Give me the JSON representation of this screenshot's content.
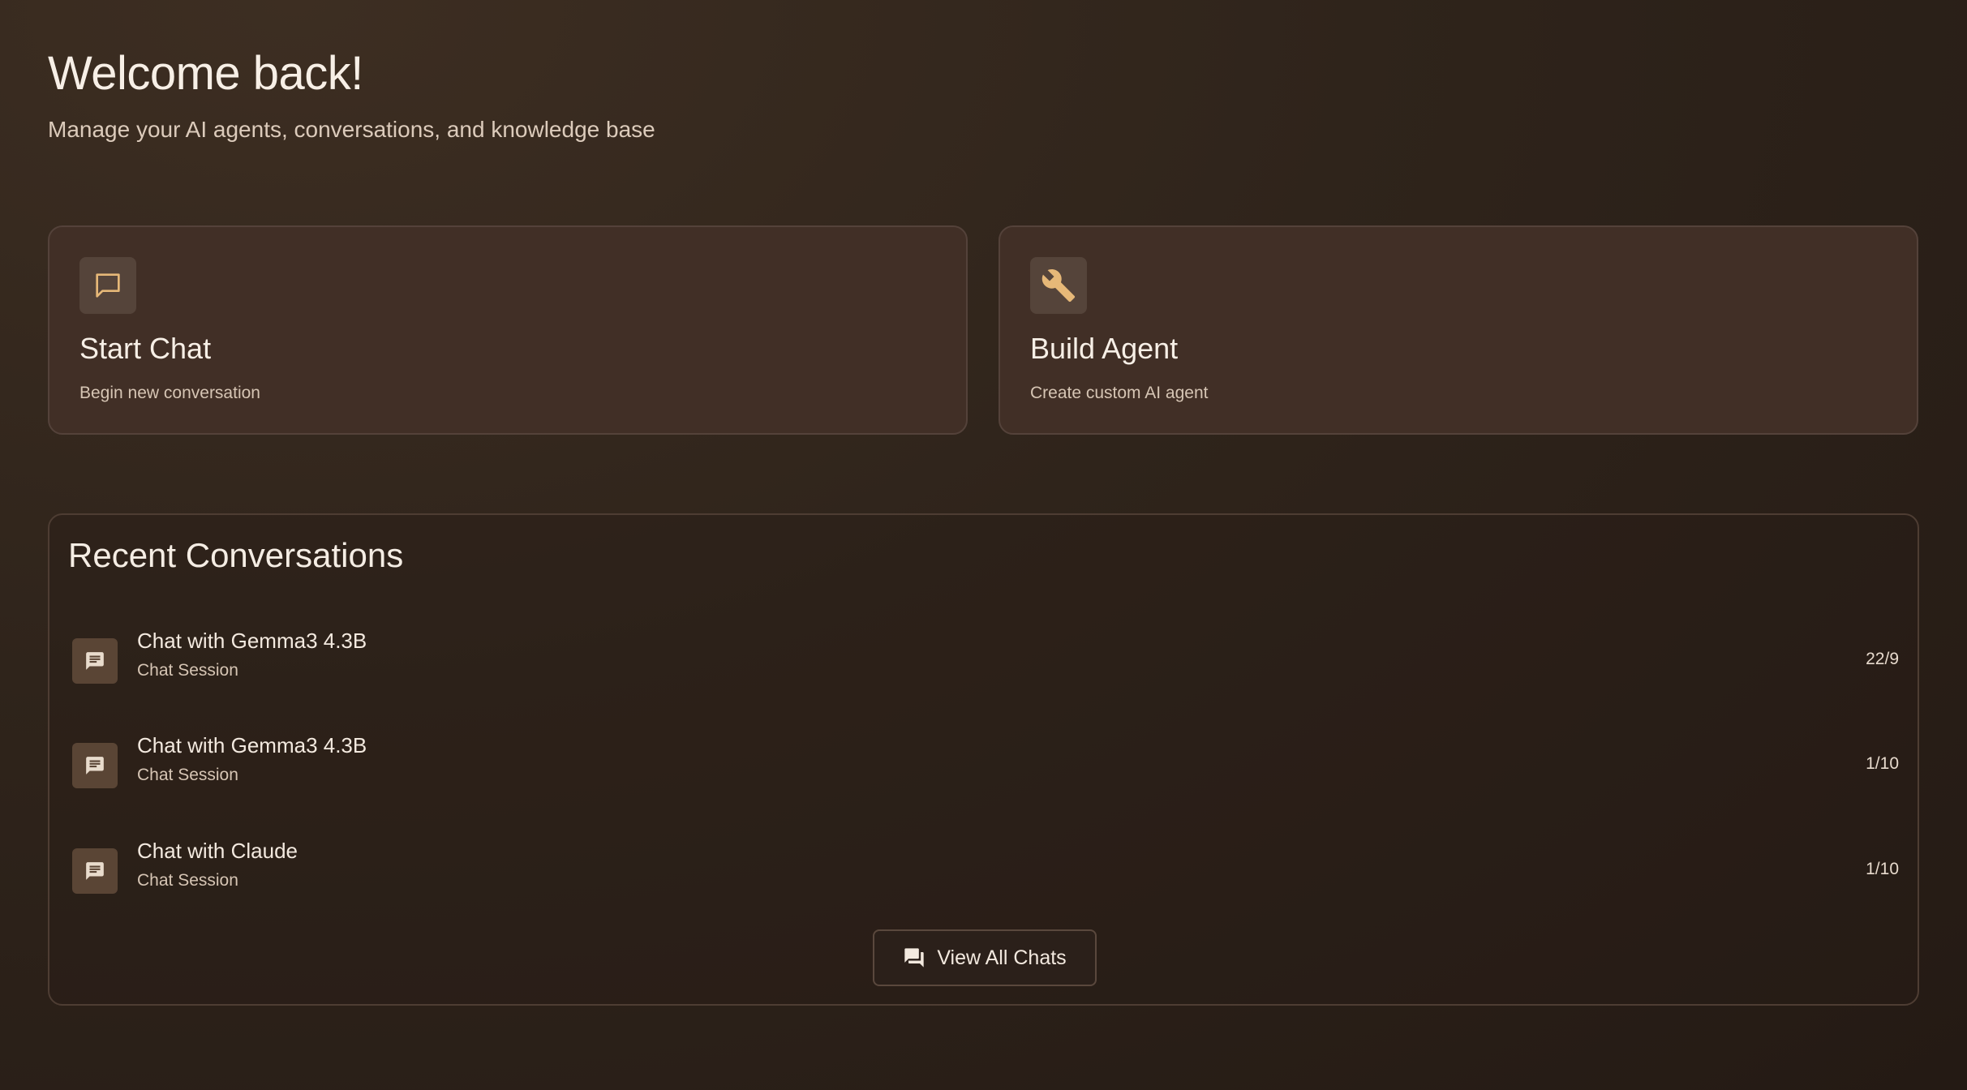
{
  "header": {
    "title": "Welcome back!",
    "subtitle": "Manage your AI agents, conversations, and knowledge base"
  },
  "quick_actions": [
    {
      "title": "Start Chat",
      "description": "Begin new conversation",
      "icon": "chat-bubble-icon"
    },
    {
      "title": "Build Agent",
      "description": "Create custom AI agent",
      "icon": "wrench-icon"
    }
  ],
  "recent": {
    "title": "Recent Conversations",
    "items": [
      {
        "title": "Chat with Gemma3 4.3B",
        "subtitle": "Chat Session",
        "date": "22/9",
        "icon": "message-icon"
      },
      {
        "title": "Chat with Gemma3 4.3B",
        "subtitle": "Chat Session",
        "date": "1/10",
        "icon": "message-icon"
      },
      {
        "title": "Chat with Claude",
        "subtitle": "Chat Session",
        "date": "1/10",
        "icon": "message-icon"
      }
    ],
    "view_all_label": "View All Chats",
    "view_all_icon": "chats-icon"
  },
  "colors": {
    "background": "#2f241b",
    "card_background": "#412f26",
    "accent": "#e6b878",
    "text": "#f3e9df"
  }
}
